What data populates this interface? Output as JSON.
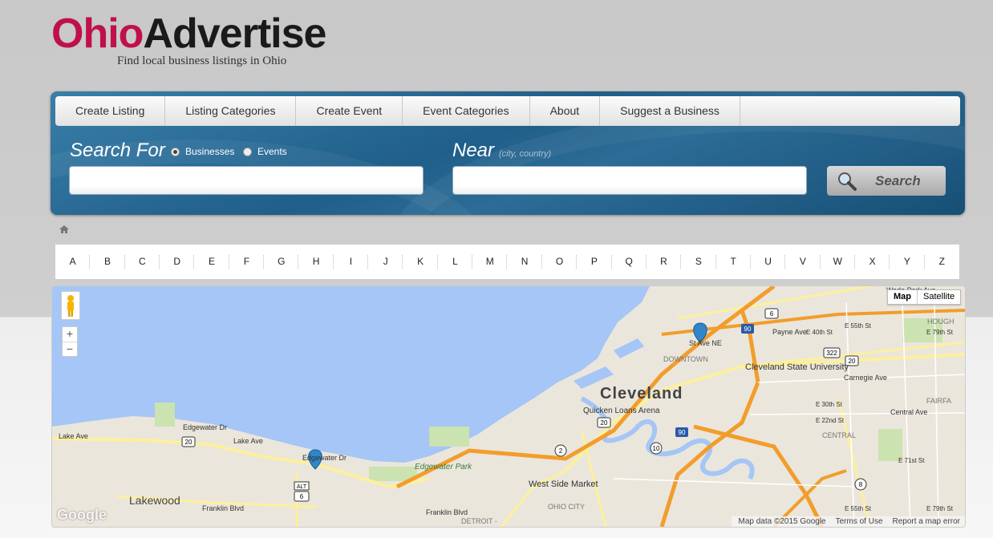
{
  "logo": {
    "part1": "Ohio",
    "part2": "Advertise",
    "tagline": "Find local business listings in Ohio"
  },
  "nav": [
    "Create Listing",
    "Listing Categories",
    "Create Event",
    "Event Categories",
    "About",
    "Suggest a Business"
  ],
  "search": {
    "search_for_label": "Search For",
    "option_businesses": "Businesses",
    "option_events": "Events",
    "selected": "Businesses",
    "near_label": "Near",
    "near_hint": "(city, country)",
    "what_value": "",
    "near_value": "",
    "button_label": "Search"
  },
  "alphabet": [
    "A",
    "B",
    "C",
    "D",
    "E",
    "F",
    "G",
    "H",
    "I",
    "J",
    "K",
    "L",
    "M",
    "N",
    "O",
    "P",
    "Q",
    "R",
    "S",
    "T",
    "U",
    "V",
    "W",
    "X",
    "Y",
    "Z"
  ],
  "map": {
    "map_btn": "Map",
    "satellite_btn": "Satellite",
    "zoom_in": "+",
    "zoom_out": "−",
    "labels": {
      "cleveland": "Cleveland",
      "downtown": "DOWNTOWN",
      "quicken": "Quicken Loans Arena",
      "csu": "Cleveland State University",
      "lakewood": "Lakewood",
      "edgewater_park": "Edgewater Park",
      "westside": "West Side Market",
      "ohiocity": "OHIO CITY",
      "detroit": "DETROIT -",
      "central": "CENTRAL",
      "fairfax": "FAIRFA",
      "hough": "HOUGH",
      "carnegie": "Carnegie Ave",
      "payne": "Payne Ave",
      "central_ave": "Central Ave",
      "lake_ave1": "Lake Ave",
      "lake_ave2": "Lake Ave",
      "edgewater_dr1": "Edgewater Dr",
      "edgewater_dr2": "Edgewater Dr",
      "franklin1": "Franklin Blvd",
      "franklin2": "Franklin Blvd",
      "st_ave": "St Ave NE",
      "wade": "Wade Park Ave",
      "e55": "E 55th St",
      "e55b": "E 55th St",
      "e40": "E 40th St",
      "e79": "E 79th St",
      "e79b": "E 79th St",
      "e71": "E 71st St",
      "e30": "E 30th St",
      "e22": "E 22nd St"
    },
    "shields": {
      "i90a": "90",
      "i90b": "90",
      "us6": "6",
      "us322": "322",
      "us20a": "20",
      "us20b": "20",
      "us20c": "20",
      "us20d": "20",
      "r2": "2",
      "r10": "10",
      "r8": "8",
      "alt": "ALT",
      "r6": "6"
    },
    "attribution": "Map data ©2015 Google",
    "terms": "Terms of Use",
    "report": "Report a map error",
    "google": "Google"
  },
  "colors": {
    "brand_red": "#c0104a",
    "search_blue": "#2a6a95",
    "water": "#a5c6f6",
    "land": "#ebe6dc",
    "highway": "#f29d2b",
    "road_yellow": "#fdf09c",
    "park": "#cbe2b1",
    "marker": "#2f86c8"
  }
}
